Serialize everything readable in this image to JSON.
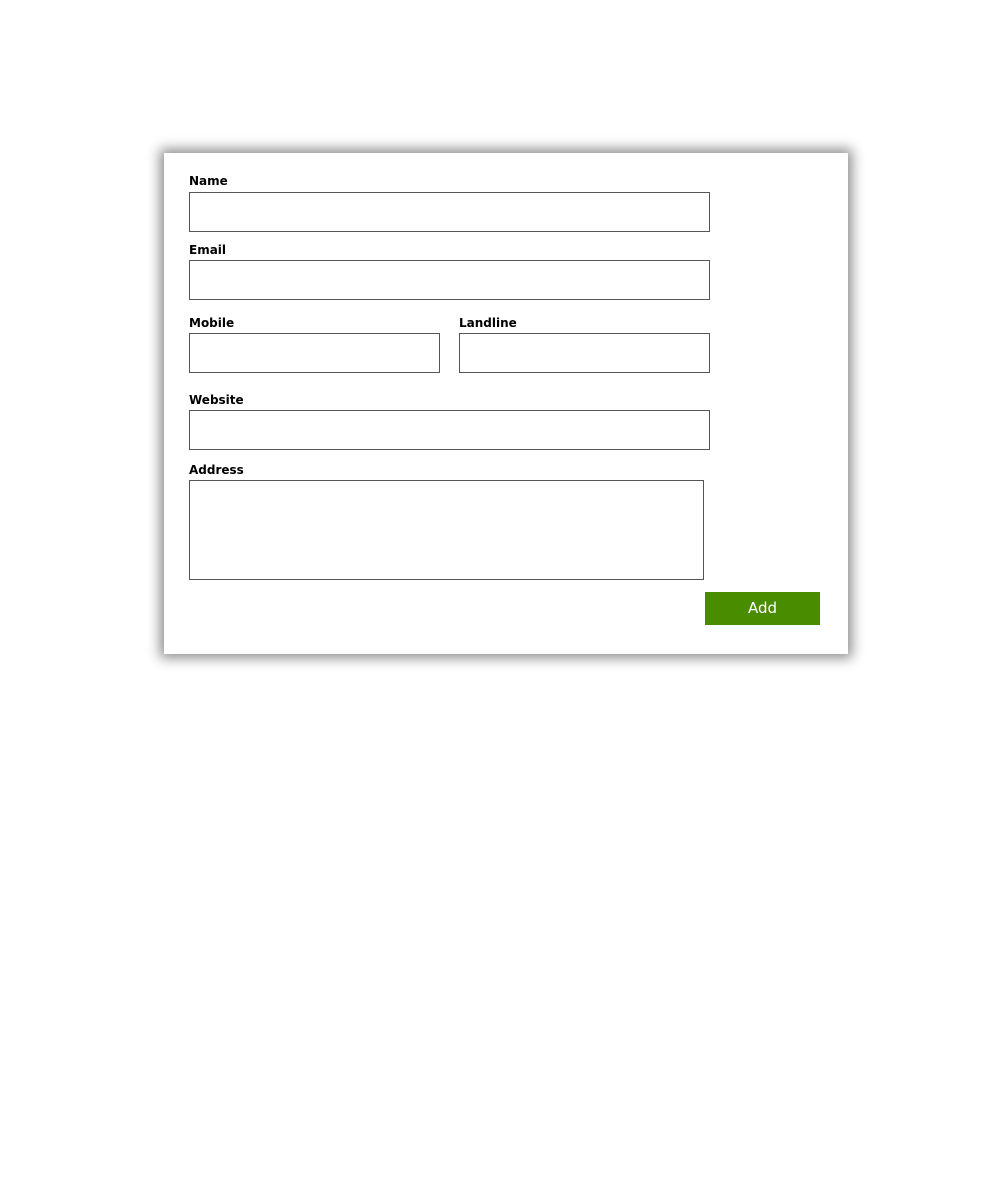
{
  "form": {
    "name": {
      "label": "Name",
      "value": ""
    },
    "email": {
      "label": "Email",
      "value": ""
    },
    "mobile": {
      "label": "Mobile",
      "value": ""
    },
    "landline": {
      "label": "Landline",
      "value": ""
    },
    "website": {
      "label": "Website",
      "value": ""
    },
    "address": {
      "label": "Address",
      "value": ""
    },
    "submit": {
      "label": "Add"
    }
  },
  "colors": {
    "accent": "#4a8c00",
    "border": "#555555",
    "card_background": "#ffffff"
  }
}
